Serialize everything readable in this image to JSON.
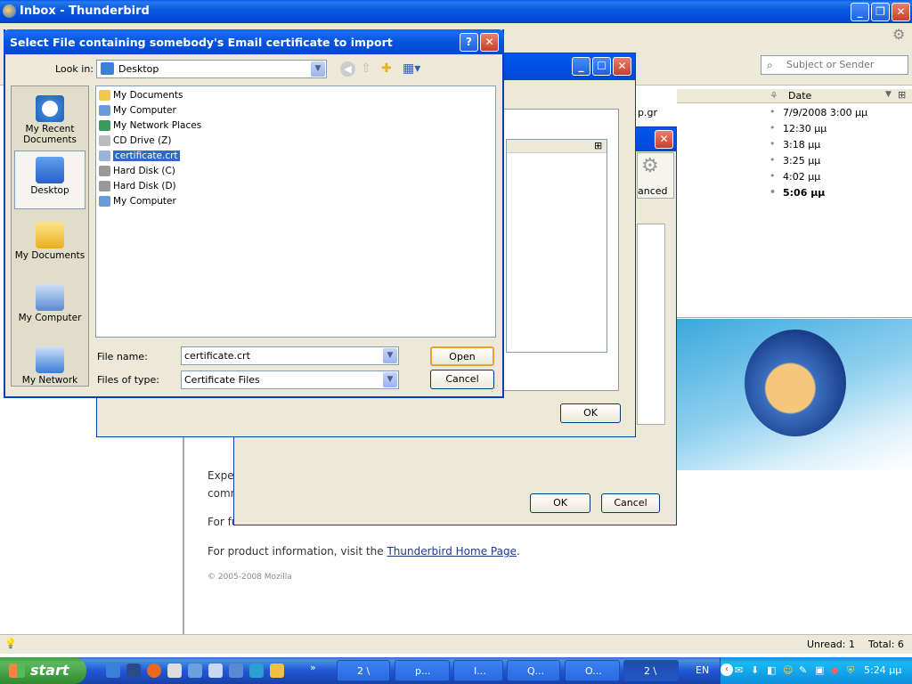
{
  "main_window": {
    "title": "Inbox - Thunderbird",
    "search_placeholder": "Subject or Sender",
    "date_column": "Date",
    "message_snippet": "p.gr",
    "dates": [
      "7/9/2008 3:00 μμ",
      "12:30 μμ",
      "3:18 μμ",
      "3:25 μμ",
      "4:02 μμ",
      "5:06 μμ"
    ],
    "preview": {
      "line1": "Expe",
      "line1b": "comm",
      "line2": "For fu",
      "line3_prefix": "For product information, visit the ",
      "line3_link": "Thunderbird Home Page",
      "line3_suffix": ".",
      "copyright": "© 2005-2008 Mozilla"
    },
    "status": {
      "unread": "Unread: 1",
      "total": "Total: 6"
    }
  },
  "bg_dialog_advanced": {
    "tab_label": "anced",
    "ok": "OK",
    "cancel": "Cancel"
  },
  "bg_dialog_certs": {
    "ok": "OK"
  },
  "file_dialog": {
    "title": "Select File containing somebody's Email certificate to import",
    "look_in_label": "Look in:",
    "look_in_value": "Desktop",
    "places": [
      "My Recent Documents",
      "Desktop",
      "My Documents",
      "My Computer",
      "My Network"
    ],
    "files": [
      "My Documents",
      "My Computer",
      "My Network Places",
      "CD Drive (Z)",
      "certificate.crt",
      "Hard Disk (C)",
      "Hard Disk (D)",
      "My Computer"
    ],
    "file_name_label": "File name:",
    "file_name_value": "certificate.crt",
    "file_type_label": "Files of type:",
    "file_type_value": "Certificate Files",
    "open": "Open",
    "cancel": "Cancel"
  },
  "taskbar": {
    "start": "start",
    "tasks": [
      "2 \\",
      "p...",
      "I...",
      "Q...",
      "O...",
      "2 \\"
    ],
    "lang": "EN",
    "clock": "5:24 μμ"
  }
}
